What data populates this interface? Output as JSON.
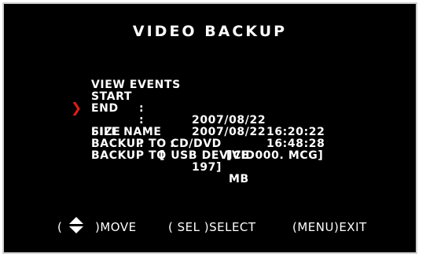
{
  "title": "VIDEO BACKUP",
  "menu": {
    "view_events": "VIEW EVENTS",
    "start": {
      "label": "START",
      "sep": ":",
      "date": "2007/08/22",
      "time": "16:20:22"
    },
    "end": {
      "label": "END",
      "sep": ":",
      "date": "2007/08/22",
      "time": "16:48:28"
    },
    "size": {
      "label": "SIZE",
      "sep": ":",
      "open": "[",
      "value": "197]",
      "unit": "MB"
    },
    "file_name": {
      "label": "FILE NAME",
      "sep": ":",
      "value": "[VID000. MCG]"
    },
    "backup_cd": "BACKUP TO CD/DVD",
    "backup_usb": "BACKUP TO USB DEVICE"
  },
  "cursor": {
    "icon": "red-chevron-right-icon",
    "glyph": "❯",
    "color": "#e21b1b",
    "selected_item": "SIZE"
  },
  "footer": {
    "move_open": "(",
    "move_icon": "up-down-arrows-icon",
    "move_close": ")MOVE",
    "select": "( SEL )SELECT",
    "exit": "(MENU)EXIT"
  }
}
